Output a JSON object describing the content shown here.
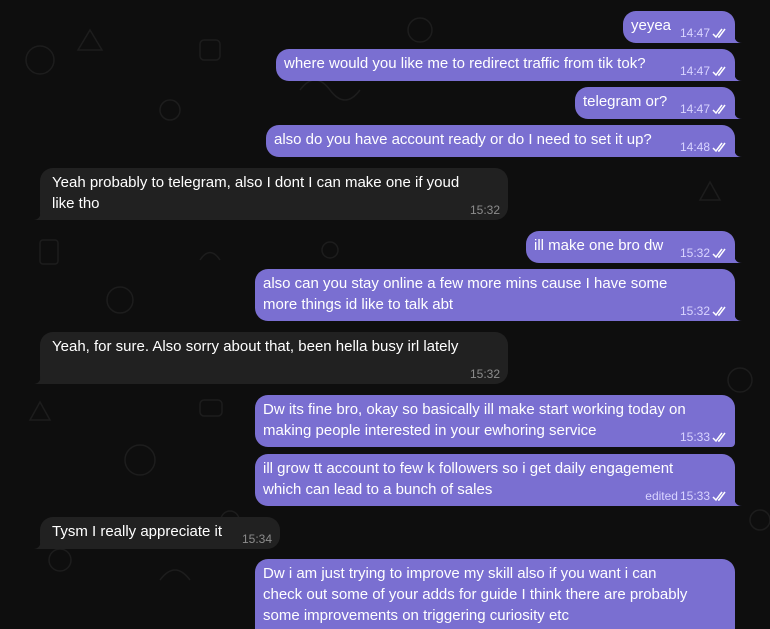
{
  "messages": [
    {
      "text": "yeyea",
      "time": "14:47"
    },
    {
      "text": "where would you like me to redirect traffic from tik tok?",
      "time": "14:47"
    },
    {
      "text": "telegram or?",
      "time": "14:47"
    },
    {
      "text": "also do you have account ready or do I need to set it up?",
      "time": "14:48"
    },
    {
      "line1": "Yeah probably to telegram, also I dont I can make one if youd",
      "line2": "like tho",
      "time": "15:32"
    },
    {
      "text": "ill make one bro dw",
      "time": "15:32"
    },
    {
      "line1": "also can you stay online a few more mins cause I have some",
      "line2": "more things id like to talk abt",
      "time": "15:32"
    },
    {
      "text": "Yeah, for sure. Also sorry about that, been hella busy irl lately",
      "time": "15:32"
    },
    {
      "line1": "Dw its fine bro, okay so basically ill make start working today on",
      "line2": "making people interested in your ewhoring service",
      "time": "15:33"
    },
    {
      "line1": "ill grow tt account to few k followers so i get daily engagement",
      "line2": "which can lead to a bunch of sales",
      "edited": "edited",
      "time": "15:33"
    },
    {
      "text": "Tysm I really appreciate it",
      "time": "15:34"
    },
    {
      "line1": "Dw i am just trying to improve my skill also if you want i can",
      "line2": "check out some of your adds for  guide I think there are probably",
      "line3": "some improvements on triggering curiosity etc"
    }
  ],
  "colors": {
    "background": "#0e0e0e",
    "outgoing_bubble": "#7a6fd1",
    "incoming_bubble": "#212121",
    "read_checks": "#ffffff"
  },
  "icons": {
    "read_receipt": "double-check-icon"
  }
}
